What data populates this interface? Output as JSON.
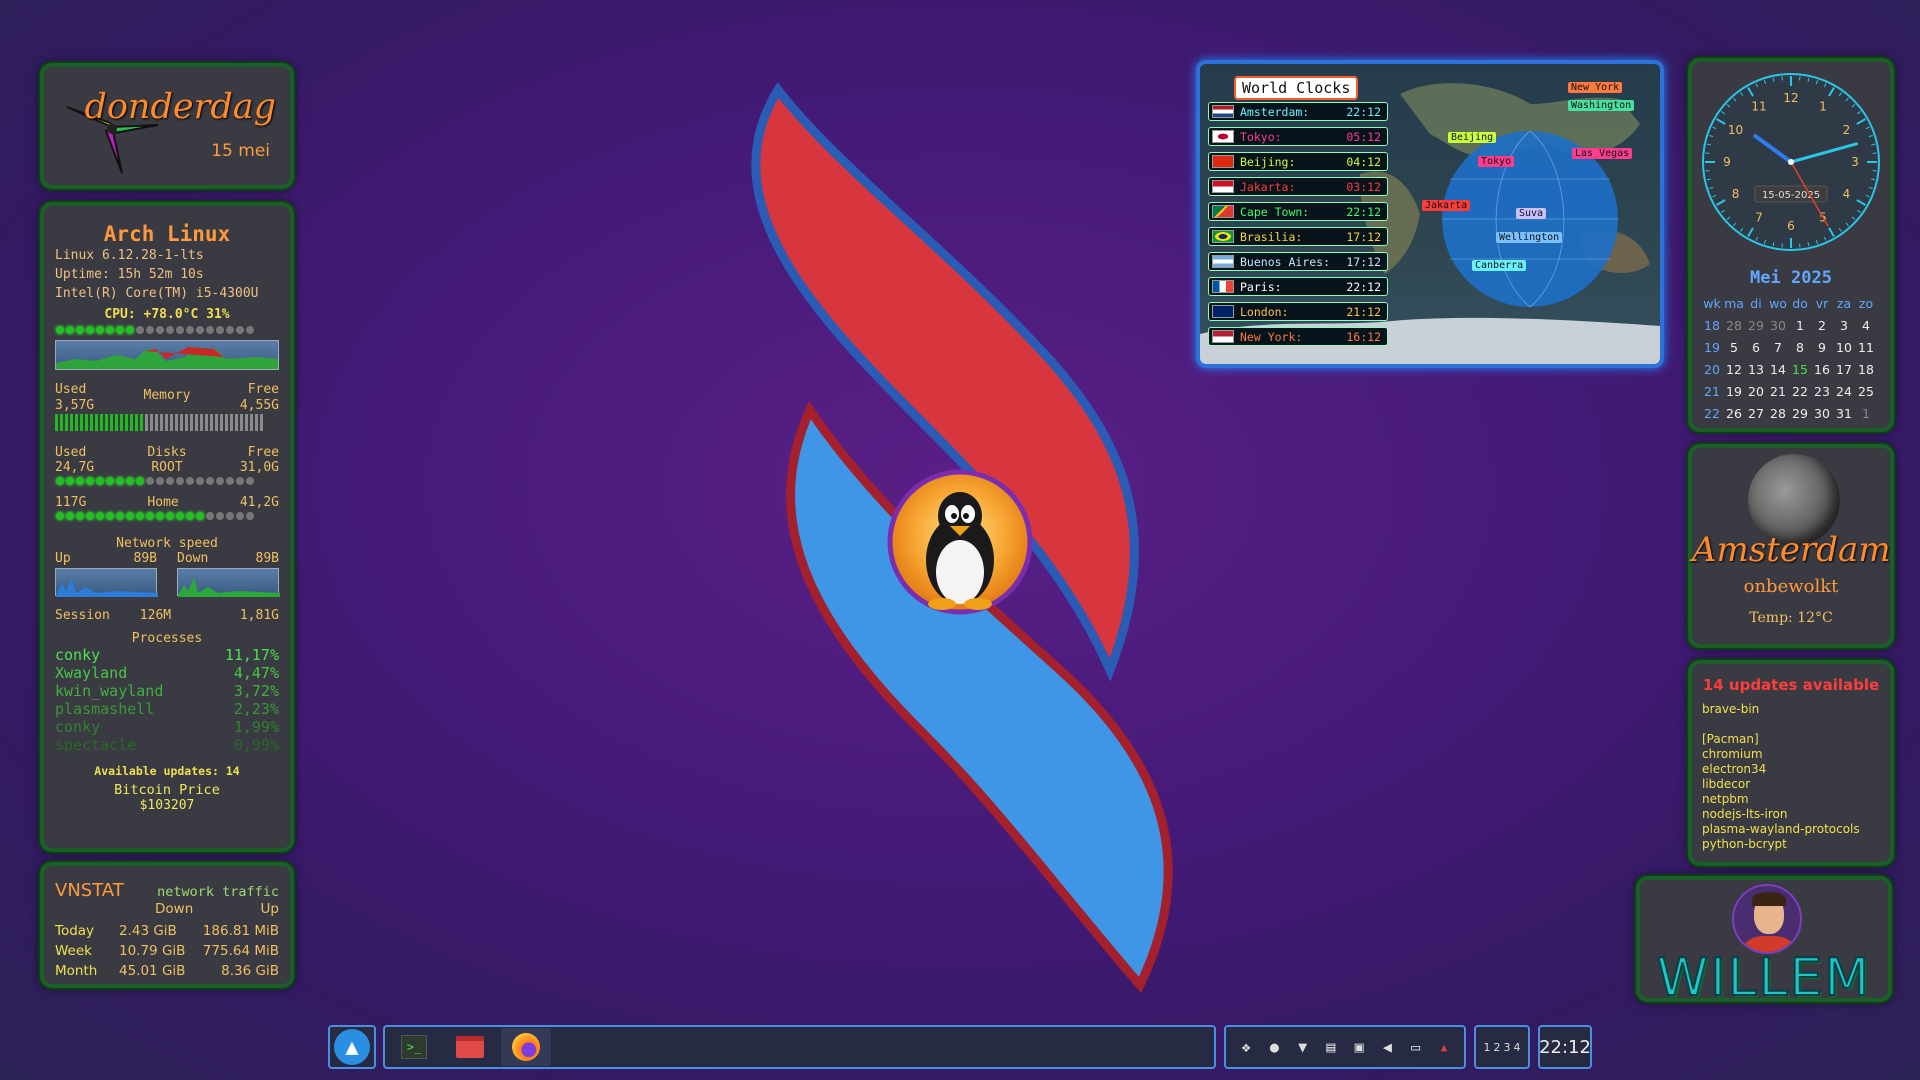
{
  "date_widget": {
    "day": "donderdag",
    "date": "15 mei"
  },
  "sysinfo": {
    "distro": "Arch Linux",
    "kernel": "Linux 6.12.28-1-lts",
    "uptime": "Uptime: 15h 52m 10s",
    "cpu_model": "Intel(R) Core(TM) i5-4300U",
    "cpu_line": "CPU: +78.0°C 31%",
    "cpu_usage": 0.31,
    "memory": {
      "used_label": "Used",
      "title": "Memory",
      "free_label": "Free",
      "used": "3,57G",
      "free": "4,55G",
      "used_fraction": 0.44
    },
    "disks": {
      "used_label": "Used",
      "title": "Disks",
      "free_label": "Free",
      "root": {
        "used": "24,7G",
        "name": "ROOT",
        "free": "31,0G",
        "fraction": 0.44
      },
      "home": {
        "used": "117G",
        "name": "Home",
        "free": "41,2G",
        "fraction": 0.74
      }
    },
    "network": {
      "title": "Network speed",
      "up_label": "Up",
      "up": "89B",
      "down_label": "Down",
      "down": "89B"
    },
    "session": {
      "label": "Session",
      "up": "126M",
      "down": "1,81G"
    },
    "processes_title": "Processes",
    "processes": [
      {
        "name": "conky",
        "cpu": "11,17%"
      },
      {
        "name": "Xwayland",
        "cpu": "4,47%"
      },
      {
        "name": "kwin_wayland",
        "cpu": "3,72%"
      },
      {
        "name": "plasmashell",
        "cpu": "2,23%"
      },
      {
        "name": "conky",
        "cpu": "1,99%"
      },
      {
        "name": "spectacle",
        "cpu": "0,99%"
      }
    ],
    "updates": "Available updates: 14",
    "btc_label": "Bitcoin Price",
    "btc_value": "$103207"
  },
  "vnstat": {
    "title": "VNSTAT",
    "subtitle": "network traffic",
    "down_header": "Down",
    "up_header": "Up",
    "rows": [
      {
        "label": "Today",
        "down": "2.43 GiB",
        "up": "186.81 MiB"
      },
      {
        "label": "Week",
        "down": "10.79 GiB",
        "up": "775.64 MiB"
      },
      {
        "label": "Month",
        "down": "45.01 GiB",
        "up": "8.36 GiB"
      }
    ]
  },
  "world_clocks": {
    "title": "World Clocks",
    "cities": [
      {
        "city": "Amsterdam:",
        "time": "22:12",
        "color": "#69f0ff"
      },
      {
        "city": "Tokyo:",
        "time": "05:12",
        "color": "#ff3c8e"
      },
      {
        "city": "Beijing:",
        "time": "04:12",
        "color": "#c9ff3c"
      },
      {
        "city": "Jakarta:",
        "time": "03:12",
        "color": "#ff3c3c"
      },
      {
        "city": "Cape Town:",
        "time": "22:12",
        "color": "#3cff6a"
      },
      {
        "city": "Brasilia:",
        "time": "17:12",
        "color": "#ffd23c"
      },
      {
        "city": "Buenos Aires:",
        "time": "17:12",
        "color": "#c4e6ff"
      },
      {
        "city": "Paris:",
        "time": "22:12",
        "color": "#ffffff"
      },
      {
        "city": "London:",
        "time": "21:12",
        "color": "#ffc04c"
      },
      {
        "city": "New York:",
        "time": "16:12",
        "color": "#ff7a3c"
      }
    ],
    "map_labels": [
      "New York",
      "Washington",
      "Beijing",
      "Tokyo",
      "Las Vegas",
      "Jakarta",
      "Suva",
      "Wellington",
      "Canberra"
    ]
  },
  "analog_clock": {
    "date": "15-05-2025",
    "numbers": [
      "12",
      "1",
      "2",
      "3",
      "4",
      "5",
      "6",
      "7",
      "8",
      "9",
      "10",
      "11"
    ],
    "hour": 10,
    "minute": 12,
    "second": 25
  },
  "calendar": {
    "title": "Mei 2025",
    "headers": [
      "wk",
      "ma",
      "di",
      "wo",
      "do",
      "vr",
      "za",
      "zo"
    ],
    "weeks": [
      [
        "18",
        "28",
        "29",
        "30",
        "1",
        "2",
        "3",
        "4"
      ],
      [
        "19",
        "5",
        "6",
        "7",
        "8",
        "9",
        "10",
        "11"
      ],
      [
        "20",
        "12",
        "13",
        "14",
        "15",
        "16",
        "17",
        "18"
      ],
      [
        "21",
        "19",
        "20",
        "21",
        "22",
        "23",
        "24",
        "25"
      ],
      [
        "22",
        "26",
        "27",
        "28",
        "29",
        "30",
        "31",
        "1"
      ]
    ],
    "today": "15"
  },
  "weather": {
    "city": "Amsterdam",
    "condition": "onbewolkt",
    "temp": "Temp: 12°C"
  },
  "updates_panel": {
    "title": "14 updates available",
    "items": [
      "brave-bin",
      "",
      "[Pacman]",
      "chromium",
      "electron34",
      "libdecor",
      "netpbm",
      "nodejs-lts-iron",
      "plasma-wayland-protocols",
      "python-bcrypt"
    ]
  },
  "user": {
    "name": "WILLEM"
  },
  "taskbar": {
    "pager": [
      "1",
      "2",
      "3",
      "4"
    ],
    "clock": "22:12"
  }
}
